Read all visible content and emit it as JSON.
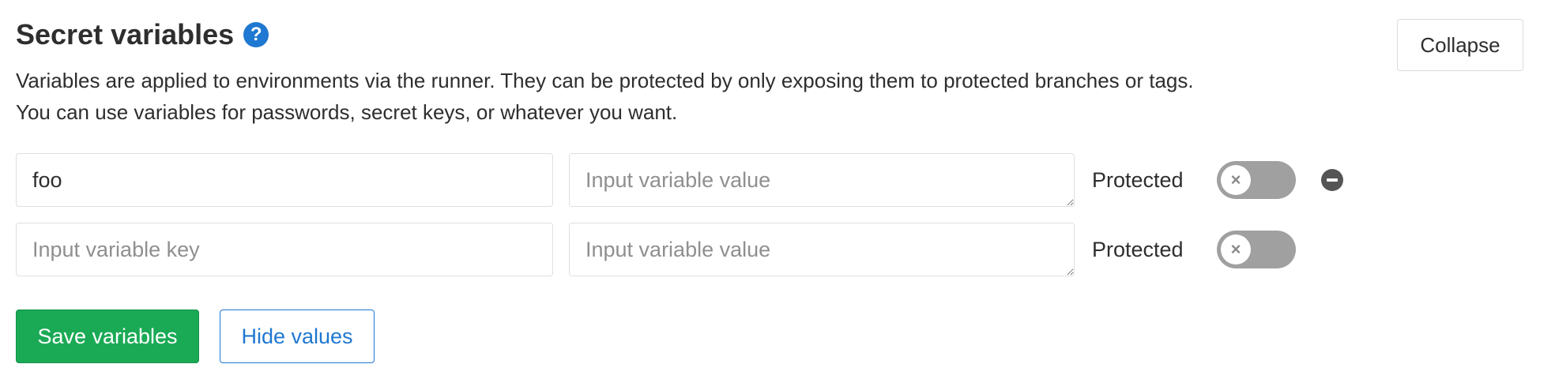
{
  "section": {
    "title": "Secret variables",
    "help_icon": "question-circle-icon",
    "collapse_label": "Collapse",
    "description_lines": [
      "Variables are applied to environments via the runner. They can be protected by only exposing them to protected branches or tags.",
      "You can use variables for passwords, secret keys, or whatever you want."
    ]
  },
  "variables": [
    {
      "key_value": "foo",
      "key_placeholder": "Input variable key",
      "value_value": "",
      "value_placeholder": "Input variable value",
      "protected_label": "Protected",
      "protected": false,
      "toggle_icon": "close-icon",
      "remove_icon": "minus-circle-icon"
    },
    {
      "key_value": "",
      "key_placeholder": "Input variable key",
      "value_value": "",
      "value_placeholder": "Input variable value",
      "protected_label": "Protected",
      "protected": false,
      "toggle_icon": "close-icon"
    }
  ],
  "actions": {
    "save_label": "Save variables",
    "hide_label": "Hide values"
  },
  "colors": {
    "primary_green": "#1aaa55",
    "link_blue": "#1f78d1",
    "toggle_off": "#a0a0a0"
  }
}
